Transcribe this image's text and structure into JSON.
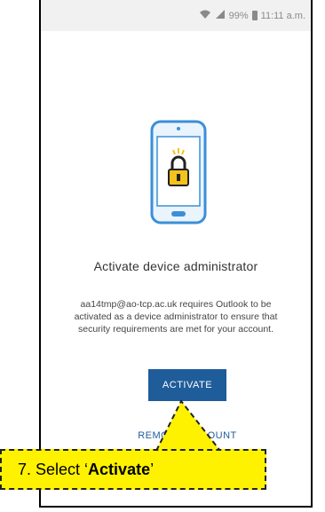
{
  "status_bar": {
    "signal": "◔",
    "battery_percent": "99%",
    "time": "11:11 a.m."
  },
  "dialog": {
    "icon": "phone-lock-icon",
    "title": "Activate device administrator",
    "message": "aa14tmp@ao-tcp.ac.uk requires Outlook to be activated as a device administrator to ensure that security requirements are met for your account.",
    "activate_label": "ACTIVATE",
    "remove_label": "REMOVE ACCOUNT"
  },
  "annotation": {
    "prefix": "7. Select ‘",
    "bold": "Activate",
    "suffix": "’"
  },
  "colors": {
    "accent": "#1f5c9a",
    "callout": "#fff200",
    "phone_outline": "#3b8fd8",
    "lock_yellow": "#f3c21b"
  }
}
